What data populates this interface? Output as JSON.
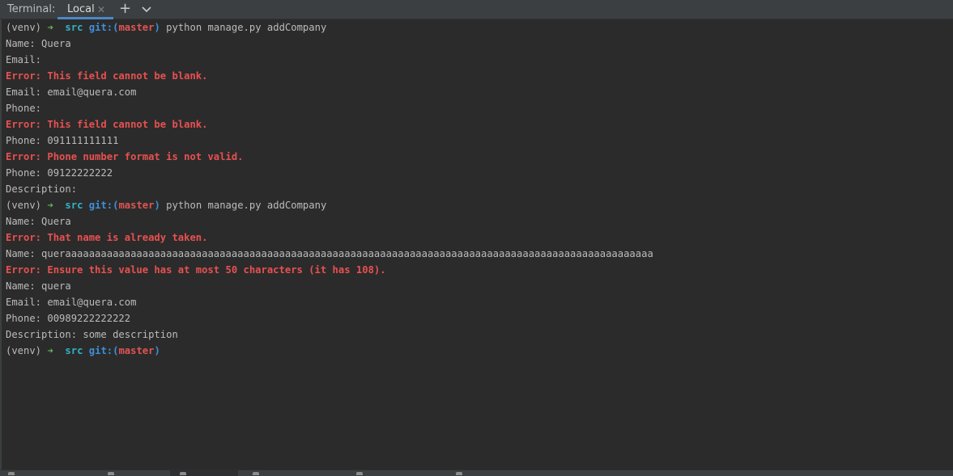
{
  "tabbar": {
    "title": "Terminal:",
    "tab_label": "Local",
    "tab_close_icon": "close-icon",
    "add_icon": "plus-icon",
    "menu_icon": "chevron-down-icon",
    "accent_color": "#4a88c7"
  },
  "terminal": {
    "colors": {
      "background": "#2b2b2b",
      "text": "#bbbbbb",
      "error": "#e85050",
      "arrow": "#5fb85f",
      "dir": "#30b3c7",
      "git": "#3f8fd8",
      "branch": "#e05454"
    },
    "lines": [
      {
        "type": "prompt",
        "venv": "(venv)",
        "arrow": "➜",
        "dir": "src",
        "git": "git:(",
        "branch": "master",
        "git_close": ")",
        "cmd": "python manage.py addCompany"
      },
      {
        "type": "text",
        "text": "Name: Quera"
      },
      {
        "type": "text",
        "text": "Email:"
      },
      {
        "type": "error",
        "text": "Error: This field cannot be blank."
      },
      {
        "type": "text",
        "text": "Email: email@quera.com"
      },
      {
        "type": "text",
        "text": "Phone:"
      },
      {
        "type": "error",
        "text": "Error: This field cannot be blank."
      },
      {
        "type": "text",
        "text": "Phone: 091111111111"
      },
      {
        "type": "error",
        "text": "Error: Phone number format is not valid."
      },
      {
        "type": "text",
        "text": "Phone: 09122222222"
      },
      {
        "type": "text",
        "text": "Description:"
      },
      {
        "type": "prompt",
        "venv": "(venv)",
        "arrow": "➜",
        "dir": "src",
        "git": "git:(",
        "branch": "master",
        "git_close": ")",
        "cmd": "python manage.py addCompany"
      },
      {
        "type": "text",
        "text": "Name: Quera"
      },
      {
        "type": "error",
        "text": "Error: That name is already taken."
      },
      {
        "type": "text",
        "text": "Name: queraaaaaaaaaaaaaaaaaaaaaaaaaaaaaaaaaaaaaaaaaaaaaaaaaaaaaaaaaaaaaaaaaaaaaaaaaaaaaaaaaaaaaaaaaaaaaaaaaaa"
      },
      {
        "type": "error",
        "text": "Error: Ensure this value has at most 50 characters (it has 108)."
      },
      {
        "type": "text",
        "text": "Name: quera"
      },
      {
        "type": "text",
        "text": "Email: email@quera.com"
      },
      {
        "type": "text",
        "text": "Phone: 00989222222222"
      },
      {
        "type": "text",
        "text": "Description: some description"
      },
      {
        "type": "prompt",
        "venv": "(venv)",
        "arrow": "➜",
        "dir": "src",
        "git": "git:(",
        "branch": "master",
        "git_close": ")",
        "cmd": ""
      }
    ]
  }
}
